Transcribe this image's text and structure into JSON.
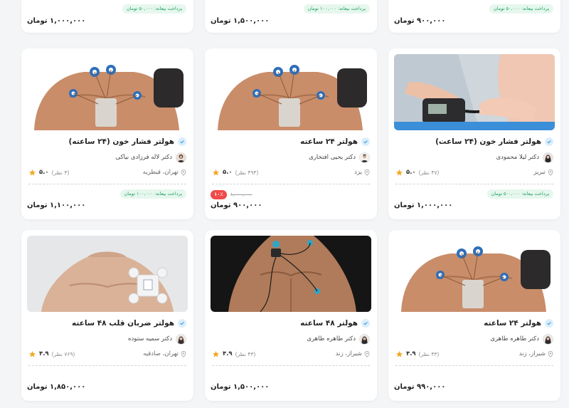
{
  "colors": {
    "accent_green": "#1e9f5b",
    "discount_red": "#f04a4a",
    "star": "#f5a623",
    "verify_blue": "#4aa3df"
  },
  "top_row": [
    {
      "pay_note": "پرداخت بیعانه: ۵۰,۰۰۰ تومان",
      "price": "۱,۰۰۰,۰۰۰ تومان"
    },
    {
      "pay_note": "پرداخت بیعانه: ۱۰۰,۰۰۰ تومان",
      "price": "۱,۵۰۰,۰۰۰ تومان"
    },
    {
      "pay_note": "پرداخت بیعانه: ۵۰,۰۰۰ تومان",
      "price": "۹۰۰,۰۰۰ تومان"
    }
  ],
  "cards": [
    {
      "title": "هولتر فشار خون (۲۴ ساعته)",
      "doctor": "دکتر لاله فرزادی نیاکی",
      "location": "تهران، قیطریه",
      "score": "۵.۰",
      "count": "(۳ نظر)",
      "pay_note": "پرداخت بیعانه: ۱۰۰,۰۰۰ تومان",
      "price": "۱,۱۰۰,۰۰۰ تومان",
      "image": "torso-bp-holter-light"
    },
    {
      "title": "هولتر ۲۴ ساعته",
      "doctor": "دکتر یحیی افتخاری",
      "location": "یزد",
      "score": "۵.۰",
      "count": "(۴۹۴ نظر)",
      "discount": "۱۰٪",
      "old_price": "۱,۰۰۰,۰۰۰",
      "price": "۹۰۰,۰۰۰ تومان",
      "image": "torso-bp-holter-light"
    },
    {
      "title": "هولتر فشار خون (۲۴ ساعت)",
      "doctor": "دکتر لیلا محمودی",
      "location": "تبریز",
      "score": "۵.۰",
      "count": "(۴۷ نظر)",
      "pay_note": "پرداخت بیعانه: ۵۰۰,۰۰۰ تومان",
      "price": "۱,۰۰۰,۰۰۰ تومان",
      "image": "hands-bp-device"
    },
    {
      "title": "هولتر ضربان قلب ۴۸ ساعته",
      "doctor": "دکتر سمیه ستوده",
      "location": "تهران، صادقیه",
      "score": "۴.۹",
      "count": "(۷۶۹ نظر)",
      "price": "۱,۸۵۰,۰۰۰ تومان",
      "image": "chest-patch-monitor"
    },
    {
      "title": "هولتر ۴۸ ساعته",
      "doctor": "دکتر طاهره طاهری",
      "location": "شیراز، زند",
      "score": "۴.۹",
      "count": "(۴۳ نظر)",
      "price": "۱,۵۰۰,۰۰۰ تومان",
      "image": "torso-dark-holter"
    },
    {
      "title": "هولتر ۲۴ ساعته",
      "doctor": "دکتر طاهره طاهری",
      "location": "شیراز، زند",
      "score": "۴.۹",
      "count": "(۴۳ نظر)",
      "price": "۹۹۰,۰۰۰ تومان",
      "image": "torso-bp-holter-light"
    }
  ]
}
